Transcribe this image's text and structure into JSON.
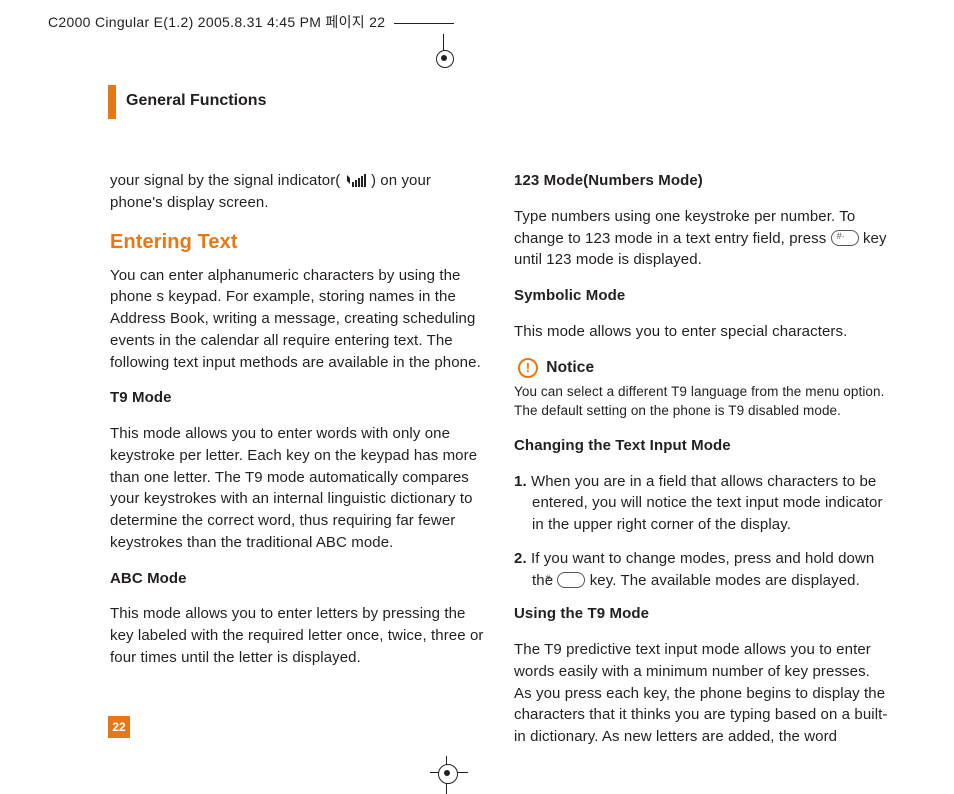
{
  "meta_line": "C2000 Cingular E(1.2)  2005.8.31 4:45 PM  페이지 22",
  "section_title": "General Functions",
  "page_number": "22",
  "left": {
    "signal_pre": "your signal by the signal indicator( ",
    "signal_post": " ) on your phone's display screen.",
    "entering_heading": "Entering Text",
    "entering_body": "You can enter alphanumeric characters by using the phone s keypad. For example, storing names in the Address Book, writing a message, creating scheduling events in the calendar all require entering text. The following text input methods are available in the phone.",
    "t9_head": "T9 Mode",
    "t9_body": "This mode allows you to enter words with only one keystroke per letter. Each key on the keypad has more than one letter. The T9 mode automatically compares your keystrokes with an internal linguistic dictionary to determine the correct word, thus requiring far fewer keystrokes than the traditional ABC mode.",
    "abc_head": "ABC Mode",
    "abc_body": "This mode allows you to enter letters by pressing the key labeled with the required letter once, twice, three or four times until the letter is displayed."
  },
  "right": {
    "mode123_head": "123 Mode(Numbers Mode)",
    "mode123_pre": "Type numbers using one keystroke per number. To change to 123 mode in a text entry field, press  ",
    "mode123_post": " key until 123 mode is displayed.",
    "symbolic_head": "Symbolic Mode",
    "symbolic_body": "This mode allows you to enter special characters.",
    "notice_label": "Notice",
    "notice_body": "You can select a different T9 language from the menu option. The default setting on the phone is T9 disabled mode.",
    "changing_head": "Changing the Text Input Mode",
    "step1_num": "1.",
    "step1_body": " When you are in a field that allows characters to be entered, you will notice the text input mode indicator in the upper right corner of the display.",
    "step2_num": "2.",
    "step2_body_pre": " If you want to change modes, press and hold down the  ",
    "step2_body_post": " key. The available modes are displayed.",
    "using_t9_head": "Using the T9 Mode",
    "using_t9_body": "The T9 predictive text input mode allows you to enter words easily with a minimum number of key presses. As you press each key, the phone begins to display the characters that it thinks you are typing based on a built-in dictionary. As new letters are added, the word"
  }
}
